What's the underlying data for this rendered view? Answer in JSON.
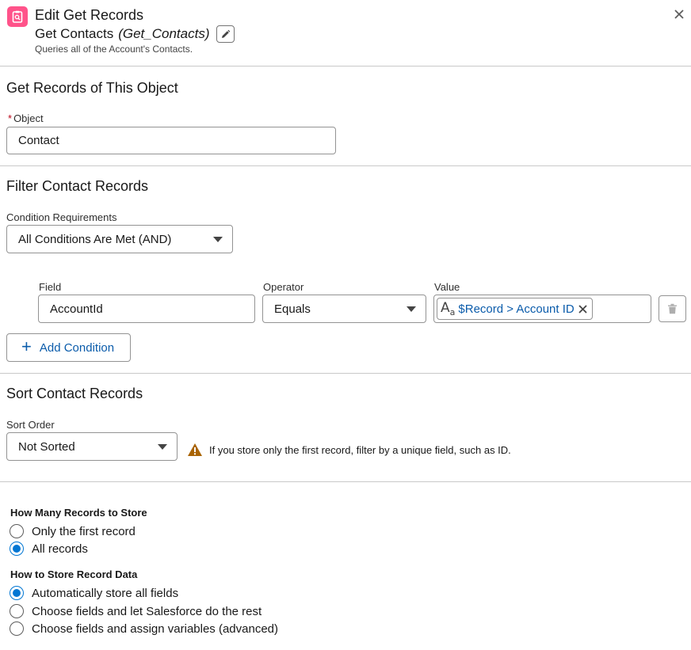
{
  "header": {
    "title": "Edit Get Records",
    "element_label": "Get Contacts",
    "element_api_name": "(Get_Contacts)",
    "description": "Queries all of the Account's Contacts.",
    "icon": "get-records-icon",
    "accent_color": "#ff538a"
  },
  "object_section": {
    "title": "Get Records of This Object",
    "object_label": "Object",
    "required_marker": "*",
    "object_value": "Contact"
  },
  "filter_section": {
    "title": "Filter Contact Records",
    "requirements_label": "Condition Requirements",
    "requirements_value": "All Conditions Are Met (AND)",
    "field_col": "Field",
    "operator_col": "Operator",
    "value_col": "Value",
    "condition": {
      "field": "AccountId",
      "operator": "Equals",
      "value": "$Record > Account ID"
    },
    "add_condition_label": "Add Condition"
  },
  "sort_section": {
    "title": "Sort Contact Records",
    "sort_order_label": "Sort Order",
    "sort_order_value": "Not Sorted",
    "warning_text": "If you store only the first record, filter by a unique field, such as ID.",
    "warning_color": "#a96404"
  },
  "store_section": {
    "how_many_label": "How Many Records to Store",
    "how_many_options": [
      "Only the first record",
      "All records"
    ],
    "how_many_selected": "All records",
    "how_store_label": "How to Store Record Data",
    "how_store_options": [
      "Automatically store all fields",
      "Choose fields and let Salesforce do the rest",
      "Choose fields and assign variables (advanced)"
    ],
    "how_store_selected": "Automatically store all fields",
    "selected_color": "#0176d3"
  }
}
